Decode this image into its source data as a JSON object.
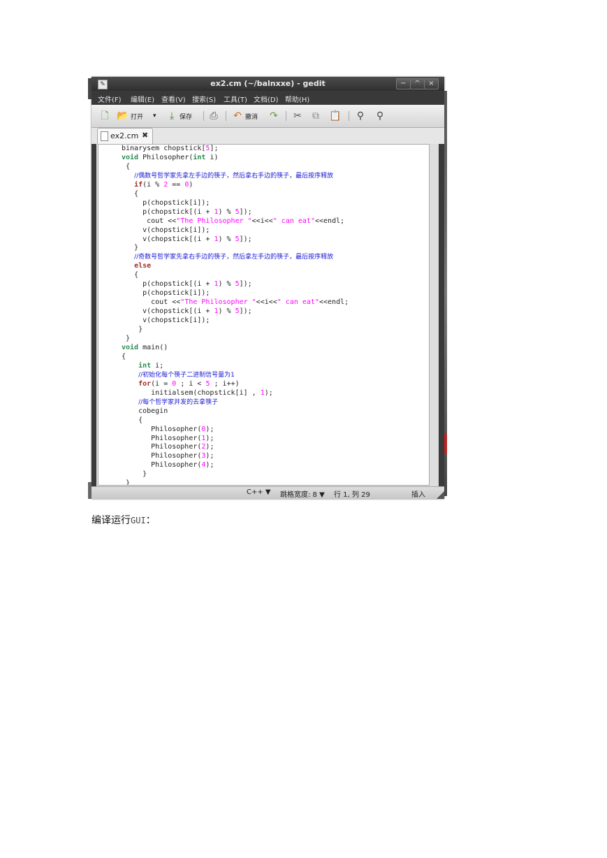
{
  "window": {
    "title": "ex2.cm (~/balnxxe) - gedit",
    "buttons": {
      "minimize": "−",
      "maximize": "^",
      "close": "×"
    }
  },
  "menubar": {
    "items": [
      "文件(F)",
      "编辑(E)",
      "查看(V)",
      "搜索(S)",
      "工具(T)",
      "文档(D)",
      "帮助(H)"
    ]
  },
  "toolbar": {
    "open_label": "打开",
    "save_label": "保存",
    "undo_label": "撤消",
    "icons": [
      "new-file-icon",
      "open-folder-icon",
      "dropdown-arrow-icon",
      "save-icon",
      "print-icon",
      "undo-icon",
      "redo-icon",
      "cut-icon",
      "copy-icon",
      "paste-icon",
      "search-icon",
      "replace-icon"
    ]
  },
  "tab": {
    "label": "ex2.cm",
    "close": "✖"
  },
  "editor": {
    "lines": [
      "binarysem chopstick[5];",
      "void Philosopher(int i)",
      "{",
      "//偶数号哲学家先拿左手边的筷子，然后拿右手边的筷子，最后按序释放",
      "if(i % 2 == 0)",
      "{",
      "p(chopstick[i]);",
      "p(chopstick[(i + 1) % 5]);",
      "cout <<\"The Philosopher \"<<i<<\" can eat\"<<endl;",
      "v(chopstick[i]);",
      "v(chopstick[(i + 1) % 5]);",
      "}",
      "//奇数号哲学家先拿右手边的筷子，然后拿左手边的筷子，最后按序释放",
      "else",
      "{",
      "p(chopstick[(i + 1) % 5]);",
      "p(chopstick[i]);",
      "cout <<\"The Philosopher \"<<i<<\" can eat\"<<endl;",
      "v(chopstick[(i + 1) % 5]);",
      "v(chopstick[i]);",
      "}",
      "}",
      "void main()",
      "{",
      "int i;",
      "//初始化每个筷子二进制信号量为1",
      "for(i = 0 ; i < 5 ; i++)",
      "initialsem(chopstick[i] , 1);",
      "//每个哲学家并发的去拿筷子",
      "cobegin",
      "{",
      "Philosopher(0);",
      "Philosopher(1);",
      "Philosopher(2);",
      "Philosopher(3);",
      "Philosopher(4);",
      "}",
      "}"
    ]
  },
  "statusbar": {
    "language": "C++ ▼",
    "tab_width": "跳格宽度: 8 ▼",
    "position": "行 1, 列 29",
    "mode": "插入"
  },
  "caption": {
    "text": "编译运行",
    "mono": "GUI",
    "suffix": "："
  },
  "colors": {
    "comment": "#1a1ad4",
    "keyword": "#a52a2a",
    "type": "#2e8b57",
    "number": "#ff00ff"
  }
}
